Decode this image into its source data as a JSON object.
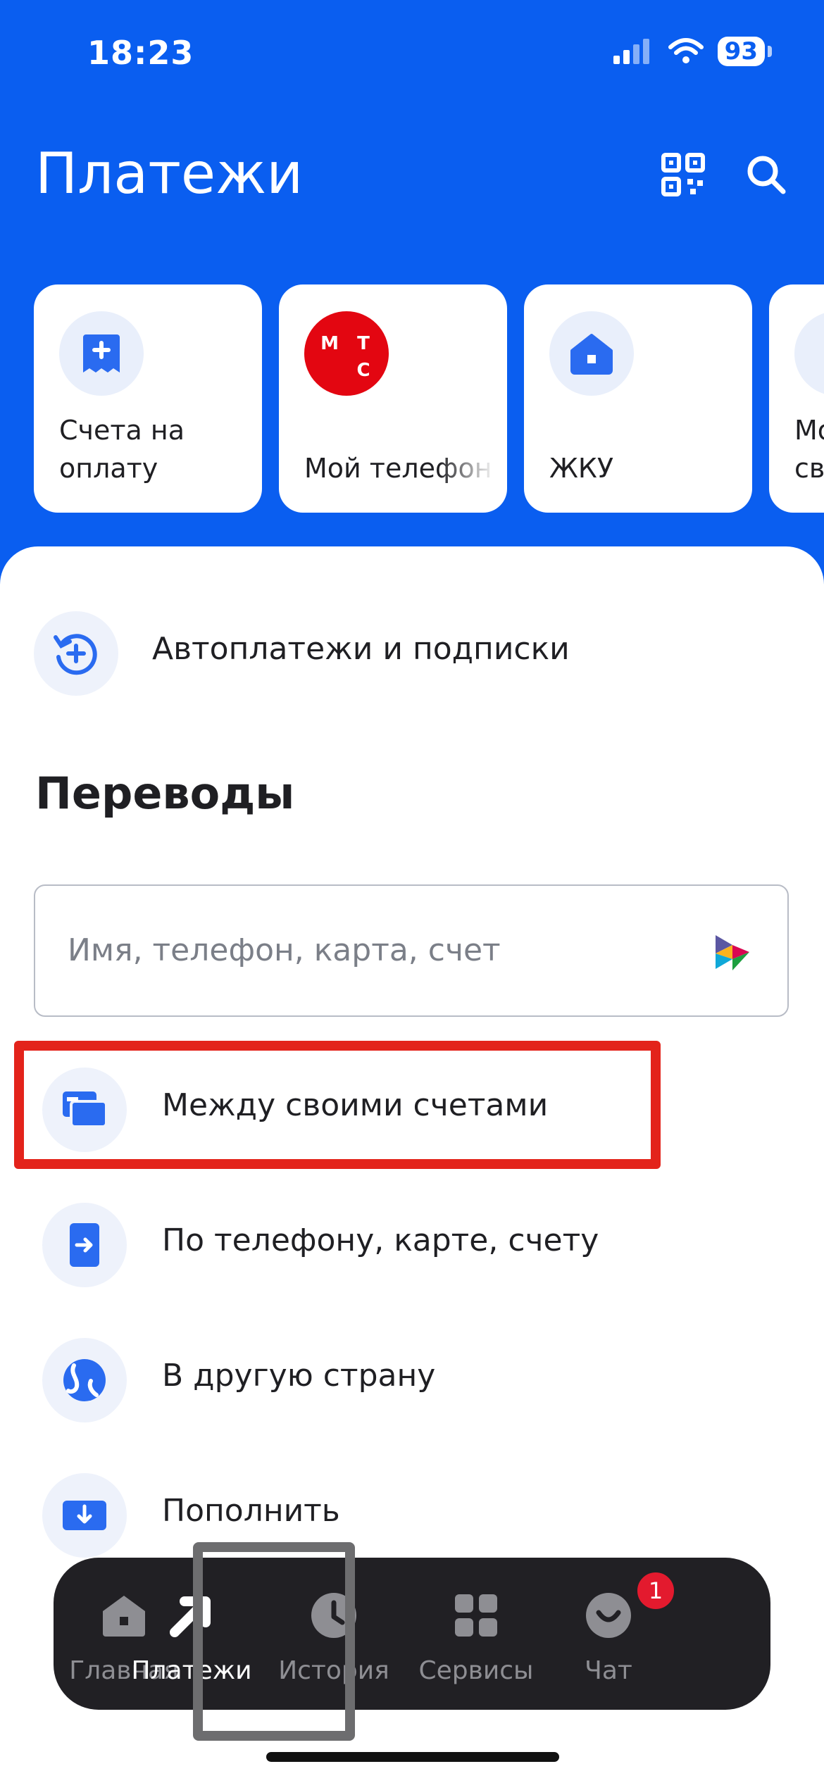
{
  "status": {
    "time": "18:23",
    "battery": "93"
  },
  "header": {
    "title": "Платежи"
  },
  "quick_cards": [
    {
      "label": "Счета на\nоплату",
      "icon": "invoice-icon"
    },
    {
      "label": "Мой телефон",
      "icon": "mts-logo",
      "logo_letters": [
        "М",
        "Т",
        "С"
      ]
    },
    {
      "label": "ЖКУ",
      "icon": "house-icon"
    },
    {
      "label": "Мо\nсв",
      "icon": "generic-icon"
    }
  ],
  "autopay": {
    "label": "Автоплатежи и подписки"
  },
  "transfers": {
    "title": "Переводы",
    "search_placeholder": "Имя, телефон, карта, счет",
    "items": [
      {
        "label": "Между своими счетами",
        "icon": "own-accounts-icon"
      },
      {
        "label": "По телефону, карте, счету",
        "icon": "transfer-arrow-icon"
      },
      {
        "label": "В другую страну",
        "icon": "globe-icon"
      },
      {
        "label": "Пополнить",
        "icon": "topup-icon"
      }
    ]
  },
  "tabbar": {
    "tabs": [
      {
        "label": "Главная"
      },
      {
        "label": "Платежи",
        "active": true
      },
      {
        "label": "История"
      },
      {
        "label": "Сервисы"
      },
      {
        "label": "Чат",
        "badge": "1"
      }
    ]
  },
  "colors": {
    "brand": "#0a5ef0",
    "highlight": "#e3231b",
    "mts": "#e30611"
  }
}
